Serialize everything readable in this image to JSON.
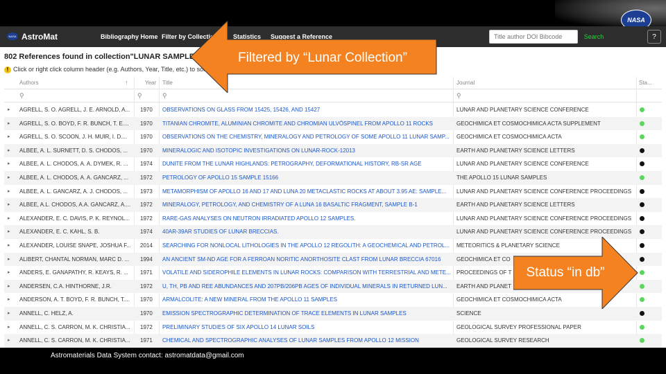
{
  "nav": {
    "brand": "AstroMat",
    "items": [
      "Bibliography Home",
      "Filter by Collection",
      "Statistics",
      "Suggest a Reference"
    ],
    "search_placeholder": "Title author DOI Bibcode",
    "search_button": "Search",
    "help_icon": "?",
    "nasa_logo": "NASA"
  },
  "result_count": "802 References found in collection\"LUNAR SAMPLES\".",
  "hint": "Click or right click column header (e.g. Authors, Year, Title, etc.) to sort; Click",
  "columns": {
    "authors": "Authors",
    "sort_icon": "↑",
    "year": "Year",
    "title": "Title",
    "journal": "Journal",
    "status": "Sta..."
  },
  "filter_icon": "⚲",
  "rows": [
    {
      "authors": "AGRELL, S. O. AGRELL, J. E. ARNOLD, A...",
      "year": "1970",
      "title": "OBSERVATIONS ON GLASS FROM 15425, 15426, AND 15427",
      "journal": "LUNAR AND PLANETARY SCIENCE CONFERENCE",
      "status": "green"
    },
    {
      "authors": "AGRELL, S. O. BOYD, F. R. BUNCH, T. E....",
      "year": "1970",
      "title": "TITANIAN CHROMITE, ALUMINIAN CHROMITE AND CHROMIAN ULVÖSPINEL FROM APOLLO 11 ROCKS",
      "journal": "GEOCHIMICA ET COSMOCHIMICA ACTA SUPPLEMENT",
      "status": "green"
    },
    {
      "authors": "AGRELL, S. O. SCOON, J. H. MUIR, I. D....",
      "year": "1970",
      "title": "OBSERVATIONS ON THE CHEMISTRY, MINERALOGY AND PETROLOGY OF SOME APOLLO 11 LUNAR SAMP...",
      "journal": "GEOCHIMICA ET COSMOCHIMICA ACTA",
      "status": "green"
    },
    {
      "authors": "ALBEE, A. L. SURNETT, D. S. CHODOS, ...",
      "year": "1970",
      "title": "MINERALOGIC AND ISOTOPIC INVESTIGATIONS ON LUNAR-ROCK-12013",
      "journal": "EARTH AND PLANETARY SCIENCE LETTERS",
      "status": "black"
    },
    {
      "authors": "ALBEE, A. L. CHODOS, A. A. DYMEK, R. ...",
      "year": "1974",
      "title": "DUNITE FROM THE LUNAR HIGHLANDS: PETROGRAPHY, DEFORMATIONAL HISTORY, RB-SR AGE",
      "journal": "LUNAR AND PLANETARY SCIENCE CONFERENCE",
      "status": "black"
    },
    {
      "authors": "ALBEE, A. L. CHODOS, A. A. GANCARZ, ...",
      "year": "1972",
      "title": "PETROLOGY OF APOLLO 15 SAMPLE 15166",
      "journal": "THE APOLLO 15 LUNAR SAMPLES",
      "status": "green"
    },
    {
      "authors": "ALBEE, A. L. GANCARZ, A. J. CHODOS, ...",
      "year": "1973",
      "title": "METAMORPHISM OF APOLLO 16 AND 17 AND LUNA 20 METACLASTIC ROCKS AT ABOUT 3.95 AE: SAMPLE...",
      "journal": "LUNAR AND PLANETARY SCIENCE CONFERENCE PROCEEDINGS",
      "status": "black"
    },
    {
      "authors": "ALBEE, A.L. CHODOS, A.A. GANCARZ, A....",
      "year": "1972",
      "title": "MINERALOGY, PETROLOGY, AND CHEMISTRY OF A LUNA 16 BASALTIC FRAGMENT, SAMPLE B-1",
      "journal": "EARTH AND PLANETARY SCIENCE LETTERS",
      "status": "black"
    },
    {
      "authors": "ALEXANDER, E. C. DAVIS, P. K. REYNOL...",
      "year": "1972",
      "title": "RARE-GAS ANALYSES ON NEUTRON IRRADIATED APOLLO 12 SAMPLES.",
      "journal": "LUNAR AND PLANETARY SCIENCE CONFERENCE PROCEEDINGS",
      "status": "black"
    },
    {
      "authors": "ALEXANDER, E. C. KAHL, S. B.",
      "year": "1974",
      "title": "40AR-39AR STUDIES OF LUNAR BRECCIAS.",
      "journal": "LUNAR AND PLANETARY SCIENCE CONFERENCE PROCEEDINGS",
      "status": "black"
    },
    {
      "authors": "ALEXANDER, LOUISE SNAPE, JOSHUA F....",
      "year": "2014",
      "title": "SEARCHING FOR NONLOCAL LITHOLOGIES IN THE APOLLO 12 REGOLITH: A GEOCHEMICAL AND PETROL...",
      "journal": "METEORITICS & PLANETARY SCIENCE",
      "status": "black"
    },
    {
      "authors": "ALIBERT, CHANTAL NORMAN, MARC D. ...",
      "year": "1994",
      "title": "AN ANCIENT SM-ND AGE FOR A FERROAN NORITIC ANORTHOSITE CLAST FROM LUNAR BRECCIA 67016",
      "journal": "GEOCHIMICA ET CO",
      "status": "black"
    },
    {
      "authors": "ANDERS, E. GANAPATHY, R. KEAYS, R. ...",
      "year": "1971",
      "title": "VOLATILE AND SIDEROPHILE ELEMENTS IN LUNAR ROCKS: COMPARISON WITH TERRESTRIAL AND METE...",
      "journal": "PROCEEDINGS OF T",
      "status": "green"
    },
    {
      "authors": "ANDERSEN, C.A. HINTHORNE, J.R.",
      "year": "1972",
      "title": "U, TH, PB AND REE ABUNDANCES AND 207PB/206PB AGES OF INDIVIDUAL MINERALS IN RETURNED LUN...",
      "journal": "EARTH AND PLANET",
      "status": "green"
    },
    {
      "authors": "ANDERSON, A. T. BOYD, F. R. BUNCH, T....",
      "year": "1970",
      "title": "ARMALCOLITE: A NEW MINERAL FROM THE APOLLO 11 SAMPLES",
      "journal": "GEOCHIMICA ET COSMOCHIMICA ACTA",
      "status": "green"
    },
    {
      "authors": "ANNELL, C. HELZ, A.",
      "year": "1970",
      "title": "EMISSION SPECTROGRAPHIC DETERMINATION OF TRACE ELEMENTS IN LUNAR SAMPLES",
      "journal": "SCIENCE",
      "status": "black"
    },
    {
      "authors": "ANNELL, C. S. CARRON, M. K. CHRISTIA...",
      "year": "1972",
      "title": "PRELIMINARY STUDIES OF SIX APOLLO 14 LUNAR SOILS",
      "journal": "GEOLOGICAL SURVEY PROFESSIONAL PAPER",
      "status": "green"
    },
    {
      "authors": "ANNELL, C. S. CARRON, M. K. CHRISTIA...",
      "year": "1971",
      "title": "CHEMICAL AND SPECTROGRAPHIC ANALYSES OF LUNAR SAMPLES FROM APOLLO 12 MISSION",
      "journal": "GEOLOGICAL SURVEY RESEARCH",
      "status": "green"
    }
  ],
  "status_colors": {
    "green": "#5cd65c",
    "black": "#111111"
  },
  "callouts": {
    "collection": "Filtered by “Lunar Collection”",
    "status": "Status “in db”"
  },
  "accent_color": "#f58220",
  "footer": "Astromaterials Data System contact: astromatdata@gmail.com"
}
